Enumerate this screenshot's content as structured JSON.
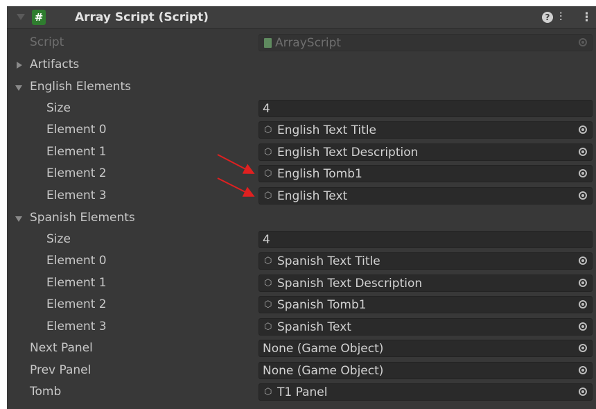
{
  "component": {
    "title": "Array Script (Script)",
    "badge": "#",
    "icons": {
      "help": "?",
      "presets": "⫶",
      "menu": "⋮"
    }
  },
  "script_row": {
    "label": "Script",
    "value": "ArrayScript"
  },
  "artifacts": {
    "label": "Artifacts"
  },
  "english": {
    "label": "English Elements",
    "size_label": "Size",
    "size_value": "4",
    "elements": [
      {
        "label": "Element 0",
        "value": "English Text Title"
      },
      {
        "label": "Element 1",
        "value": "English Text Description"
      },
      {
        "label": "Element 2",
        "value": "English Tomb1"
      },
      {
        "label": "Element 3",
        "value": "English Text"
      }
    ]
  },
  "spanish": {
    "label": "Spanish Elements",
    "size_label": "Size",
    "size_value": "4",
    "elements": [
      {
        "label": "Element 0",
        "value": "Spanish Text Title"
      },
      {
        "label": "Element 1",
        "value": "Spanish Text Description"
      },
      {
        "label": "Element 2",
        "value": "Spanish Tomb1"
      },
      {
        "label": "Element 3",
        "value": "Spanish Text"
      }
    ]
  },
  "next_panel": {
    "label": "Next Panel",
    "value": "None (Game Object)"
  },
  "prev_panel": {
    "label": "Prev Panel",
    "value": "None (Game Object)"
  },
  "tomb": {
    "label": "Tomb",
    "value": "T1 Panel"
  },
  "annotation_color": "#e02020"
}
